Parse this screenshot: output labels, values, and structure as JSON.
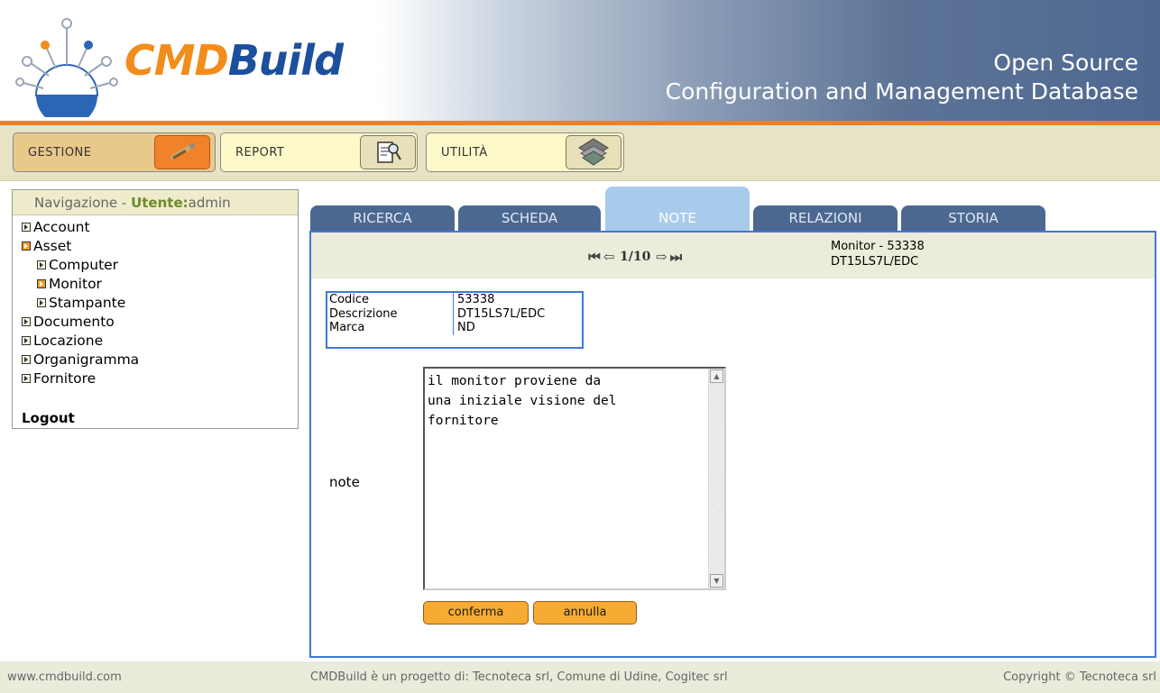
{
  "header": {
    "logo_part1": "CMD",
    "logo_part2": "Build",
    "tagline_line1": "Open Source",
    "tagline_line2": "Configuration and Management Database"
  },
  "menu": {
    "gestione": "GESTIONE",
    "report": "REPORT",
    "utilita": "UTILITÀ"
  },
  "sidebar": {
    "title_prefix": "Navigazione - ",
    "user_label": "Utente:",
    "user_name": "admin",
    "items": [
      {
        "label": "Account",
        "level": 0,
        "open": false
      },
      {
        "label": "Asset",
        "level": 0,
        "open": true
      },
      {
        "label": "Computer",
        "level": 1,
        "open": false
      },
      {
        "label": "Monitor",
        "level": 1,
        "open": true
      },
      {
        "label": "Stampante",
        "level": 1,
        "open": false
      },
      {
        "label": "Documento",
        "level": 0,
        "open": false
      },
      {
        "label": "Locazione",
        "level": 0,
        "open": false
      },
      {
        "label": "Organigramma",
        "level": 0,
        "open": false
      },
      {
        "label": "Fornitore",
        "level": 0,
        "open": false
      }
    ],
    "logout": "Logout"
  },
  "tabs": {
    "ricerca": "RICERCA",
    "scheda": "SCHEDA",
    "note": "NOTE",
    "relazioni": "RELAZIONI",
    "storia": "STORIA",
    "active": "NOTE"
  },
  "pager": {
    "text": "1/10"
  },
  "card": {
    "title_line1": "Monitor - 53338",
    "title_line2": "DT15LS7L/EDC"
  },
  "info": {
    "rows": [
      {
        "key": "Codice",
        "value": "53338"
      },
      {
        "key": "Descrizione",
        "value": "DT15LS7L/EDC"
      },
      {
        "key": "Marca",
        "value": "ND"
      }
    ]
  },
  "note": {
    "label": "note",
    "value": "il monitor proviene da\nuna iniziale visione del\nfornitore"
  },
  "buttons": {
    "confirm": "conferma",
    "cancel": "annulla"
  },
  "footer": {
    "left": "www.cmdbuild.com",
    "middle": "CMDBuild è un progetto di: Tecnoteca srl, Comune di Udine, Cogitec srl",
    "right": "Copyright © Tecnoteca srl"
  },
  "colors": {
    "accent_orange": "#f28c1b",
    "brand_blue": "#1c4f9c",
    "tab_blue": "#4b6891",
    "tab_active": "#a9cbeb"
  }
}
